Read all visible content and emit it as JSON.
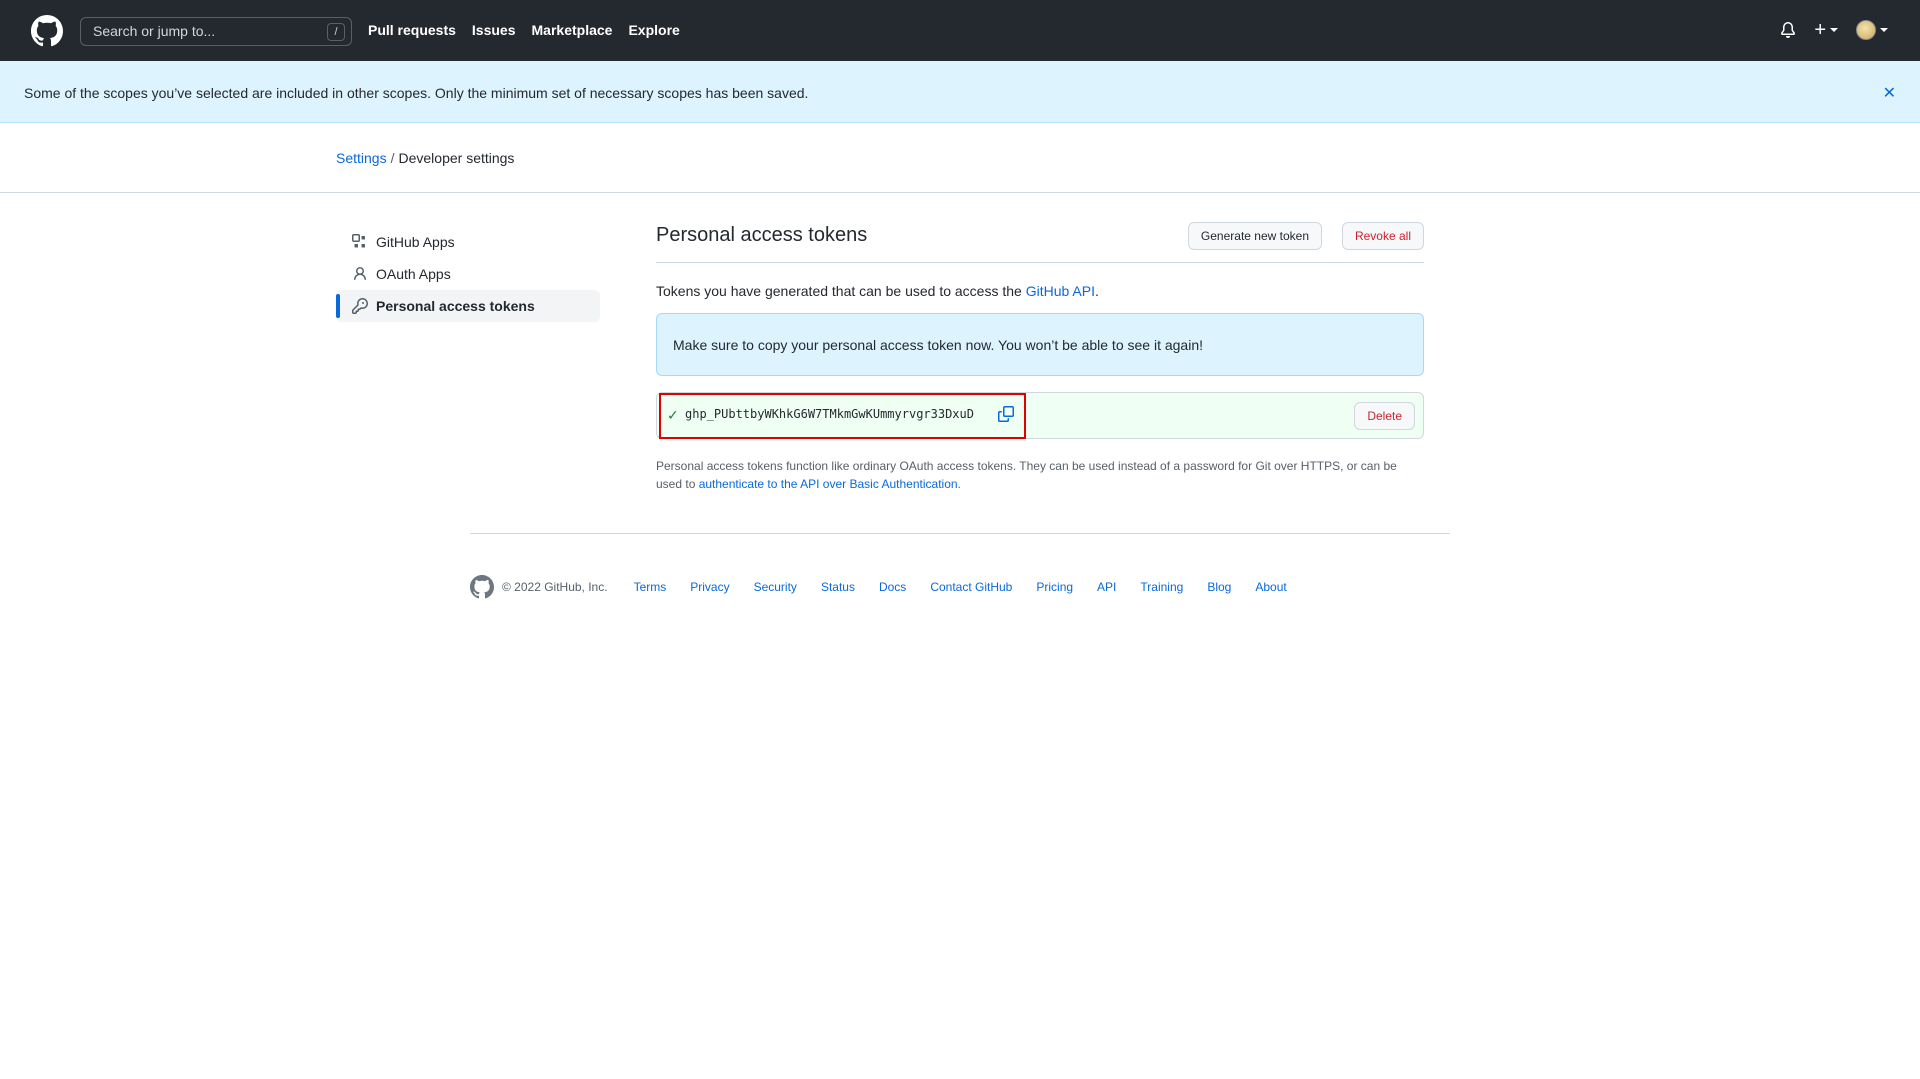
{
  "header": {
    "search_placeholder": "Search or jump to...",
    "slash_key": "/",
    "nav": [
      "Pull requests",
      "Issues",
      "Marketplace",
      "Explore"
    ]
  },
  "flash": {
    "message": "Some of the scopes you’ve selected are included in other scopes. Only the minimum set of necessary scopes has been saved.",
    "close": "✕"
  },
  "breadcrumb": {
    "settings": "Settings",
    "separator": "/",
    "current": "Developer settings"
  },
  "sidebar": {
    "items": [
      {
        "label": "GitHub Apps",
        "icon": "apps-icon"
      },
      {
        "label": "OAuth Apps",
        "icon": "person-icon"
      },
      {
        "label": "Personal access tokens",
        "icon": "key-icon",
        "active": true
      }
    ]
  },
  "main": {
    "title": "Personal access tokens",
    "generate_button": "Generate new token",
    "revoke_button": "Revoke all",
    "intro_text": "Tokens you have generated that can be used to access the ",
    "intro_link": "GitHub API",
    "intro_end": ".",
    "info_message": "Make sure to copy your personal access token now. You won’t be able to see it again!",
    "token_check": "✓",
    "token_value": "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",
    "delete_button": "Delete",
    "note_text": "Personal access tokens function like ordinary OAuth access tokens. They can be used instead of a password for Git over HTTPS, or can be used to ",
    "note_link": "authenticate to the API over Basic Authentication",
    "note_end": "."
  },
  "footer": {
    "copyright": "© 2022 GitHub, Inc.",
    "links": [
      "Terms",
      "Privacy",
      "Security",
      "Status",
      "Docs",
      "Contact GitHub",
      "Pricing",
      "API",
      "Training",
      "Blog",
      "About"
    ]
  },
  "colors": {
    "header_bg": "#24292f",
    "flash_bg": "#ddf4ff",
    "link": "#0969da",
    "danger": "#cf222e",
    "success": "#1a7f37",
    "highlight_border": "#e00000"
  }
}
